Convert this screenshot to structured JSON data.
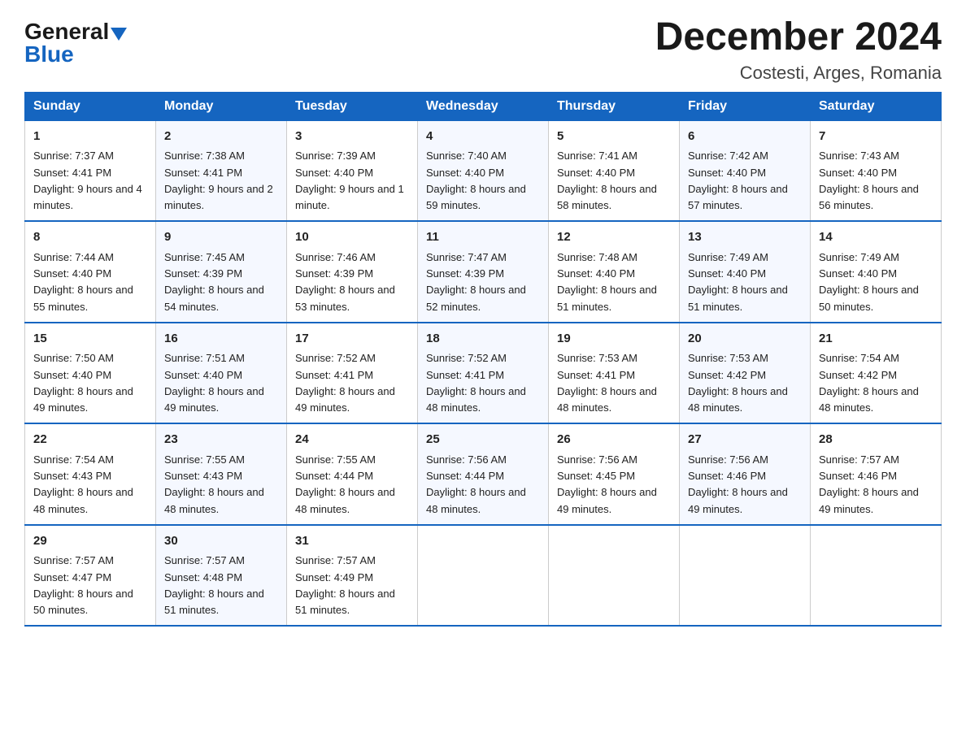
{
  "logo": {
    "general": "General",
    "blue": "Blue"
  },
  "title": "December 2024",
  "location": "Costesti, Arges, Romania",
  "days_of_week": [
    "Sunday",
    "Monday",
    "Tuesday",
    "Wednesday",
    "Thursday",
    "Friday",
    "Saturday"
  ],
  "weeks": [
    [
      {
        "day": "1",
        "sunrise": "7:37 AM",
        "sunset": "4:41 PM",
        "daylight": "9 hours and 4 minutes."
      },
      {
        "day": "2",
        "sunrise": "7:38 AM",
        "sunset": "4:41 PM",
        "daylight": "9 hours and 2 minutes."
      },
      {
        "day": "3",
        "sunrise": "7:39 AM",
        "sunset": "4:40 PM",
        "daylight": "9 hours and 1 minute."
      },
      {
        "day": "4",
        "sunrise": "7:40 AM",
        "sunset": "4:40 PM",
        "daylight": "8 hours and 59 minutes."
      },
      {
        "day": "5",
        "sunrise": "7:41 AM",
        "sunset": "4:40 PM",
        "daylight": "8 hours and 58 minutes."
      },
      {
        "day": "6",
        "sunrise": "7:42 AM",
        "sunset": "4:40 PM",
        "daylight": "8 hours and 57 minutes."
      },
      {
        "day": "7",
        "sunrise": "7:43 AM",
        "sunset": "4:40 PM",
        "daylight": "8 hours and 56 minutes."
      }
    ],
    [
      {
        "day": "8",
        "sunrise": "7:44 AM",
        "sunset": "4:40 PM",
        "daylight": "8 hours and 55 minutes."
      },
      {
        "day": "9",
        "sunrise": "7:45 AM",
        "sunset": "4:39 PM",
        "daylight": "8 hours and 54 minutes."
      },
      {
        "day": "10",
        "sunrise": "7:46 AM",
        "sunset": "4:39 PM",
        "daylight": "8 hours and 53 minutes."
      },
      {
        "day": "11",
        "sunrise": "7:47 AM",
        "sunset": "4:39 PM",
        "daylight": "8 hours and 52 minutes."
      },
      {
        "day": "12",
        "sunrise": "7:48 AM",
        "sunset": "4:40 PM",
        "daylight": "8 hours and 51 minutes."
      },
      {
        "day": "13",
        "sunrise": "7:49 AM",
        "sunset": "4:40 PM",
        "daylight": "8 hours and 51 minutes."
      },
      {
        "day": "14",
        "sunrise": "7:49 AM",
        "sunset": "4:40 PM",
        "daylight": "8 hours and 50 minutes."
      }
    ],
    [
      {
        "day": "15",
        "sunrise": "7:50 AM",
        "sunset": "4:40 PM",
        "daylight": "8 hours and 49 minutes."
      },
      {
        "day": "16",
        "sunrise": "7:51 AM",
        "sunset": "4:40 PM",
        "daylight": "8 hours and 49 minutes."
      },
      {
        "day": "17",
        "sunrise": "7:52 AM",
        "sunset": "4:41 PM",
        "daylight": "8 hours and 49 minutes."
      },
      {
        "day": "18",
        "sunrise": "7:52 AM",
        "sunset": "4:41 PM",
        "daylight": "8 hours and 48 minutes."
      },
      {
        "day": "19",
        "sunrise": "7:53 AM",
        "sunset": "4:41 PM",
        "daylight": "8 hours and 48 minutes."
      },
      {
        "day": "20",
        "sunrise": "7:53 AM",
        "sunset": "4:42 PM",
        "daylight": "8 hours and 48 minutes."
      },
      {
        "day": "21",
        "sunrise": "7:54 AM",
        "sunset": "4:42 PM",
        "daylight": "8 hours and 48 minutes."
      }
    ],
    [
      {
        "day": "22",
        "sunrise": "7:54 AM",
        "sunset": "4:43 PM",
        "daylight": "8 hours and 48 minutes."
      },
      {
        "day": "23",
        "sunrise": "7:55 AM",
        "sunset": "4:43 PM",
        "daylight": "8 hours and 48 minutes."
      },
      {
        "day": "24",
        "sunrise": "7:55 AM",
        "sunset": "4:44 PM",
        "daylight": "8 hours and 48 minutes."
      },
      {
        "day": "25",
        "sunrise": "7:56 AM",
        "sunset": "4:44 PM",
        "daylight": "8 hours and 48 minutes."
      },
      {
        "day": "26",
        "sunrise": "7:56 AM",
        "sunset": "4:45 PM",
        "daylight": "8 hours and 49 minutes."
      },
      {
        "day": "27",
        "sunrise": "7:56 AM",
        "sunset": "4:46 PM",
        "daylight": "8 hours and 49 minutes."
      },
      {
        "day": "28",
        "sunrise": "7:57 AM",
        "sunset": "4:46 PM",
        "daylight": "8 hours and 49 minutes."
      }
    ],
    [
      {
        "day": "29",
        "sunrise": "7:57 AM",
        "sunset": "4:47 PM",
        "daylight": "8 hours and 50 minutes."
      },
      {
        "day": "30",
        "sunrise": "7:57 AM",
        "sunset": "4:48 PM",
        "daylight": "8 hours and 51 minutes."
      },
      {
        "day": "31",
        "sunrise": "7:57 AM",
        "sunset": "4:49 PM",
        "daylight": "8 hours and 51 minutes."
      },
      null,
      null,
      null,
      null
    ]
  ]
}
